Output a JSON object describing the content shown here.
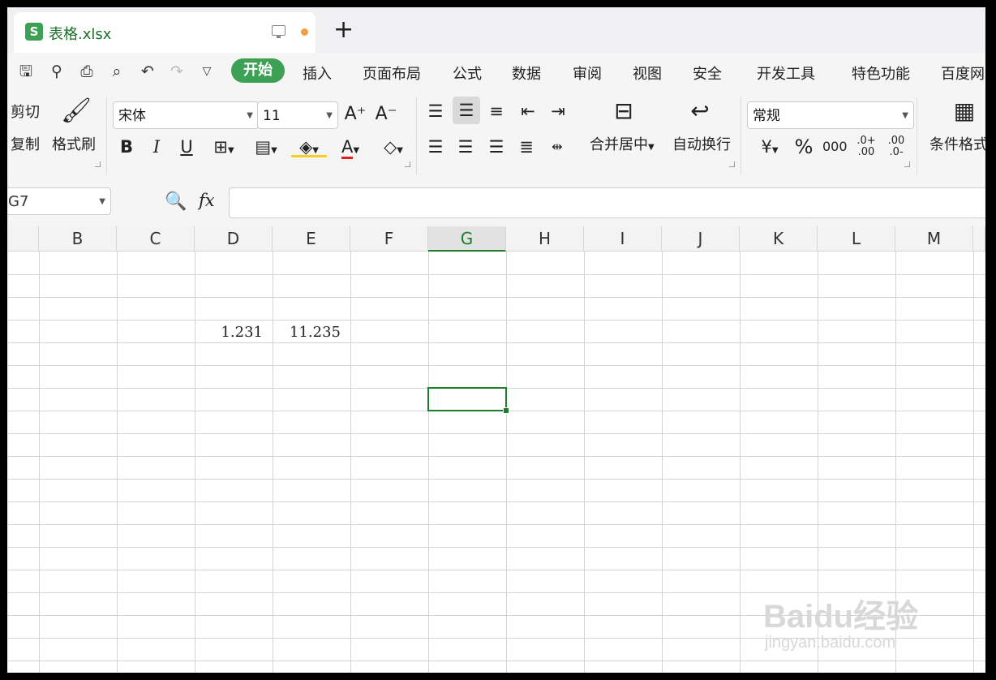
{
  "tab": {
    "title": "表格.xlsx"
  },
  "menu": {
    "items": [
      "开始",
      "插入",
      "页面布局",
      "公式",
      "数据",
      "审阅",
      "视图",
      "安全",
      "开发工具",
      "特色功能",
      "百度网"
    ]
  },
  "ribbon": {
    "cut": "剪切",
    "copy": "复制",
    "format_painter": "格式刷",
    "font_name": "宋体",
    "font_size": "11",
    "merge_center": "合并居中",
    "wrap_text": "自动换行",
    "number_format": "常规",
    "conditional_format": "条件格式",
    "bold": "B",
    "italic": "I",
    "underline": "U",
    "font_color": "A",
    "percent": "%"
  },
  "formula_bar": {
    "name_box": "G7",
    "fx": "fx",
    "formula": ""
  },
  "columns": [
    "B",
    "C",
    "D",
    "E",
    "F",
    "G",
    "H",
    "I",
    "J",
    "K",
    "L",
    "M"
  ],
  "selected_column": "G",
  "cells": {
    "D4": "1.231",
    "E4": "11.235"
  },
  "watermark": {
    "main": "Baidu经验",
    "sub": "jingyan.baidu.com"
  },
  "colors": {
    "accent": "#3ca055",
    "selection": "#1a7d2a"
  }
}
